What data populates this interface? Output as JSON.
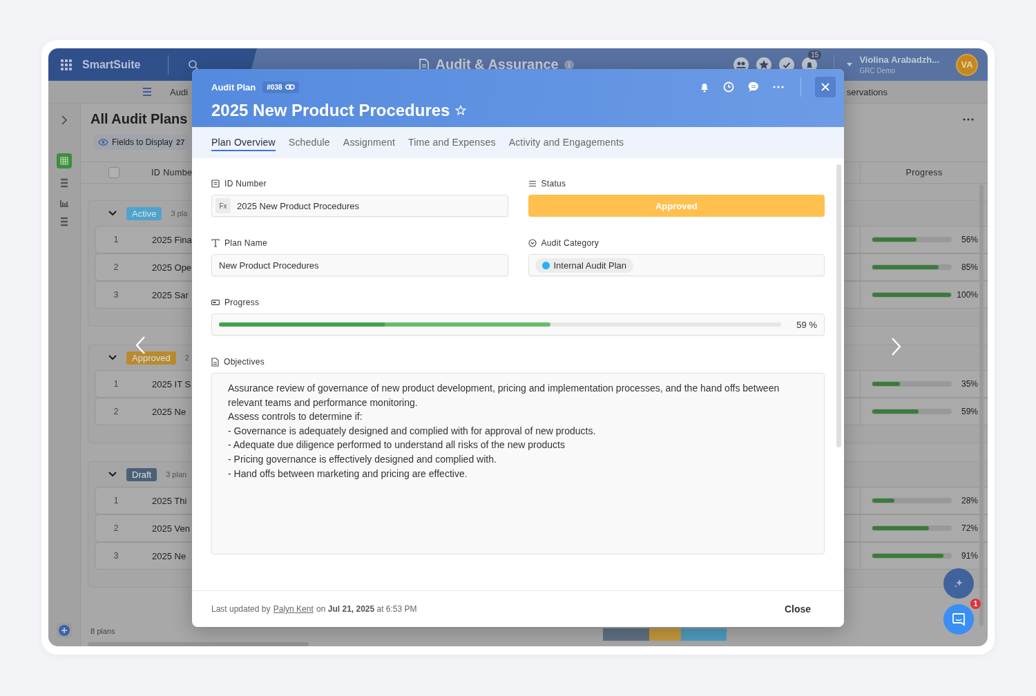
{
  "app": {
    "brand": "SmartSuite",
    "solution_title": "Audit & Assurance",
    "notification_count": "15",
    "user_name": "Violina Arabadzh...",
    "workspace": "GRC Demo",
    "user_initials": "VA"
  },
  "subnav": [
    "Audi",
    "servations"
  ],
  "view": {
    "title": "All Audit Plans",
    "select_all_checked": false,
    "fields_label": "Fields to Display",
    "fields_count": "27",
    "columns": [
      "ID Numbe",
      "Progress"
    ],
    "groups": [
      {
        "status": "Active",
        "color": "#4fa3cb",
        "count": "3 pla",
        "expanded": true,
        "rows": [
          {
            "number": "1",
            "name": "2025 Fina",
            "level": 0.56,
            "reading": "56%"
          },
          {
            "number": "2",
            "name": "2025 Ope",
            "level": 0.85,
            "reading": "85%"
          },
          {
            "number": "3",
            "name": "2025 Sar",
            "level": 1,
            "reading": "100%"
          }
        ]
      },
      {
        "status": "Approved",
        "color": "#b98b2e",
        "count": "2",
        "expanded": true,
        "rows": [
          {
            "number": "1",
            "name": "2025 IT S",
            "level": 0.35,
            "reading": "35%"
          },
          {
            "number": "2",
            "name": "2025 Ne",
            "level": 0.59,
            "reading": "59%"
          }
        ]
      },
      {
        "status": "Draft",
        "color": "#4a6075",
        "count": "3 plan",
        "expanded": true,
        "rows": [
          {
            "number": "1",
            "name": "2025 Thi",
            "level": 0.28,
            "reading": "28%"
          },
          {
            "number": "2",
            "name": "2025 Ven",
            "level": 0.72,
            "reading": "72%"
          },
          {
            "number": "3",
            "name": "2025 Ne",
            "level": 0.91,
            "reading": "91%"
          }
        ]
      }
    ],
    "row_count": "8 plans",
    "summary_segments": [
      {
        "color": "#5f7182"
      },
      {
        "color": "#c4993d"
      },
      {
        "color": "#4e9cc2"
      }
    ]
  },
  "record": {
    "type_label": "Audit Plan",
    "record_number": "#038",
    "title": "2025 New Product Procedures",
    "starred": false,
    "tabs": [
      {
        "label": "Plan Overview",
        "selected": true
      },
      {
        "label": "Schedule",
        "selected": false
      },
      {
        "label": "Assignment",
        "selected": false
      },
      {
        "label": "Time and Expenses",
        "selected": false
      },
      {
        "label": "Activity and Engagements",
        "selected": false
      }
    ],
    "fields": [
      {
        "kind": "formula",
        "label": "ID Number",
        "prefix": "Fx",
        "value": "2025 New Product Procedures"
      },
      {
        "kind": "status",
        "label": "Status",
        "value": "Approved",
        "color": "#ffc04f"
      },
      {
        "kind": "text",
        "label": "Plan Name",
        "value": "New Product Procedures"
      },
      {
        "kind": "tag",
        "label": "Audit Category",
        "value": "Internal Audit Plan",
        "color": "#2bb0f2"
      },
      {
        "kind": "progress",
        "label": "Progress",
        "level": 0.59,
        "reading": "59 %"
      }
    ],
    "objectives": {
      "label": "Objectives",
      "text": "Assurance review of governance of new product development, pricing and implementation processes, and the hand offs between relevant teams and performance monitoring.\nAssess controls to determine if:\n- Governance is adequately designed and complied with for approval of new products.\n- Adequate due diligence performed to understand all risks of the new products\n- Pricing governance is effectively designed and complied with.\n- Hand offs between marketing and pricing are effective."
    },
    "footer": {
      "text_before": "Last updated by",
      "author": "Palyn Kent",
      "text_after": "on **Jul 21, 2025** at 6:53 PM"
    },
    "close_label": "Close"
  },
  "floating": {
    "chat_badge": "1"
  }
}
